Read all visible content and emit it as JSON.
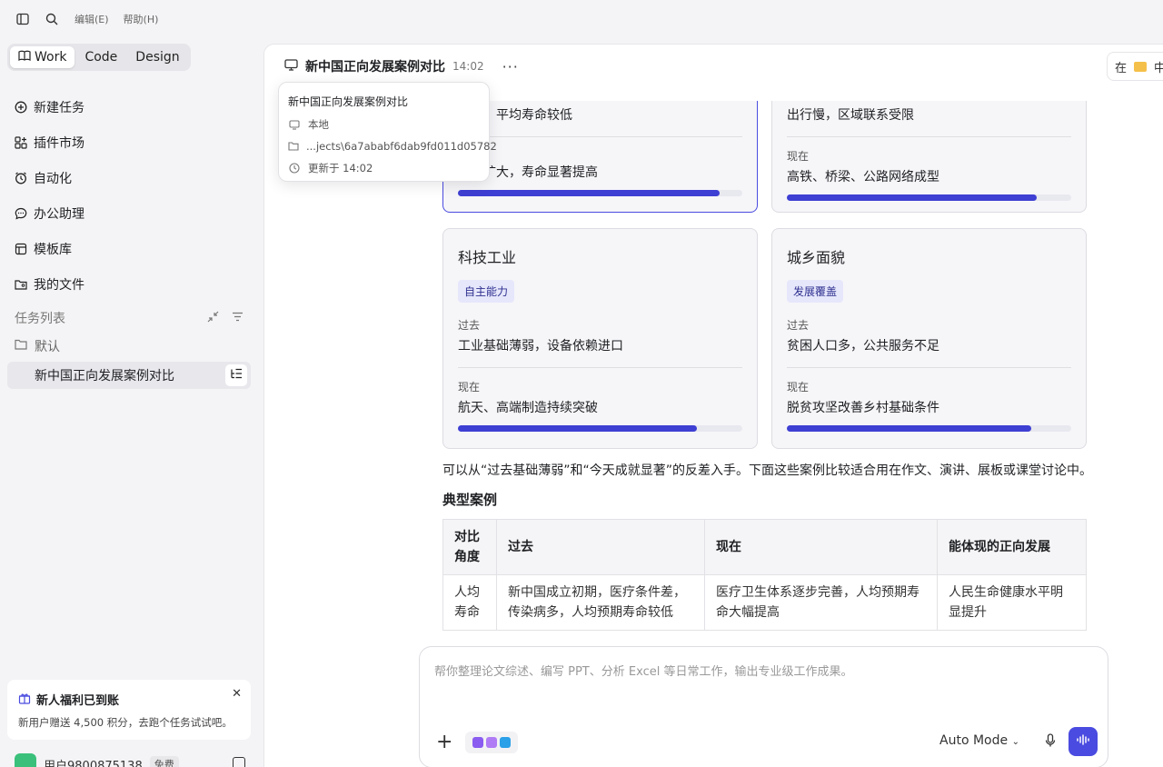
{
  "menu": {
    "edit": "编辑(E)",
    "help": "帮助(H)"
  },
  "modes": [
    {
      "label": "Work",
      "active": true
    },
    {
      "label": "Code",
      "active": false
    },
    {
      "label": "Design",
      "active": false
    }
  ],
  "nav": [
    {
      "label": "新建任务",
      "icon": "plus-circle-icon"
    },
    {
      "label": "插件市场",
      "icon": "grid-plus-icon"
    },
    {
      "label": "自动化",
      "icon": "alarm-clock-icon"
    },
    {
      "label": "办公助理",
      "icon": "chat-bubble-icon"
    },
    {
      "label": "模板库",
      "icon": "template-icon"
    },
    {
      "label": "我的文件",
      "icon": "folder-user-icon"
    }
  ],
  "tasks": {
    "heading": "任务列表",
    "group": "默认",
    "item": "新中国正向发展案例对比"
  },
  "promo": {
    "title": "新人福利已到账",
    "desc": "新用户赠送 4,500 积分，去跑个任务试试吧。"
  },
  "user": {
    "name": "用户9800875138",
    "badge": "免费"
  },
  "header": {
    "title": "新中国正向发展案例对比",
    "time": "14:02",
    "right_text": "在",
    "right_text2": "中"
  },
  "tooltip": {
    "title": "新中国正向发展案例对比",
    "location": "本地",
    "path": "...jects\\6a7ababf6dab9fd011d05782",
    "updated": "更新于 14:02"
  },
  "cards": [
    {
      "past_value": "少药，平均寿命较低",
      "now_value": "保障扩大，寿命显著提高",
      "progress": 0.92
    },
    {
      "past_value": "出行慢，区域联系受限",
      "now_label": "现在",
      "now_value": "高铁、桥梁、公路网络成型",
      "progress": 0.88
    },
    {
      "title": "科技工业",
      "tag": "自主能力",
      "past_label": "过去",
      "past_value": "工业基础薄弱，设备依赖进口",
      "now_label": "现在",
      "now_value": "航天、高端制造持续突破",
      "progress": 0.84
    },
    {
      "title": "城乡面貌",
      "tag": "发展覆盖",
      "past_label": "过去",
      "past_value": "贫困人口多，公共服务不足",
      "now_label": "现在",
      "now_value": "脱贫攻坚改善乡村基础条件",
      "progress": 0.86
    }
  ],
  "paragraph": "可以从“过去基础薄弱”和“今天成就显著”的反差入手。下面这些案例比较适合用在作文、演讲、展板或课堂讨论中。",
  "section_title": "典型案例",
  "table": {
    "headers": [
      "对比角度",
      "过去",
      "现在",
      "能体现的正向发展"
    ],
    "rows": [
      [
        "人均寿命",
        "新中国成立初期，医疗条件差，传染病多，人均预期寿命较低",
        "医疗卫生体系逐步完善，人均预期寿命大幅提高",
        "人民生命健康水平明显提升"
      ]
    ]
  },
  "composer": {
    "placeholder": "帮你整理论文综述、编写 PPT、分析 Excel 等日常工作，输出专业级工作成果。",
    "mode": "Auto Mode"
  },
  "colors": {
    "accent": "#4a4be0",
    "bar": "#3e3fd3",
    "tag_bg": "#e6e7fb"
  }
}
